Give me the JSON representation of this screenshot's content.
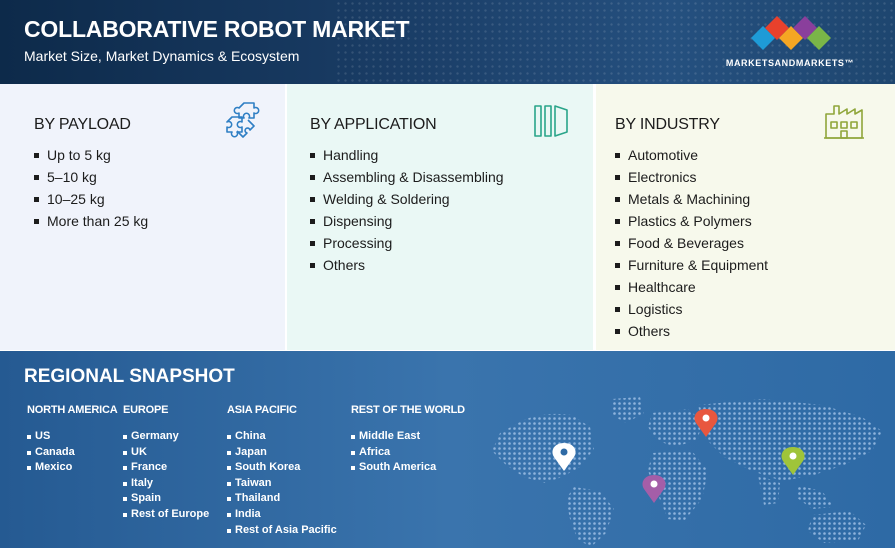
{
  "header": {
    "title": "COLLABORATIVE ROBOT MARKET",
    "subtitle": "Market Size, Market Dynamics & Ecosystem",
    "brand": "MARKETSANDMARKETS™",
    "logo_colors": [
      "#e8412c",
      "#f5a623",
      "#7ab648",
      "#1e9bd7",
      "#8a3f9c"
    ]
  },
  "segments": [
    {
      "heading": "BY PAYLOAD",
      "icon": "puzzle-icon",
      "items": [
        "Up to 5 kg",
        "5–10 kg",
        "10–25 kg",
        "More than 25 kg"
      ]
    },
    {
      "heading": "BY APPLICATION",
      "icon": "layers-icon",
      "items": [
        "Handling",
        "Assembling & Disassembling",
        "Welding & Soldering",
        "Dispensing",
        "Processing",
        "Others"
      ]
    },
    {
      "heading": "BY INDUSTRY",
      "icon": "factory-icon",
      "items": [
        "Automotive",
        "Electronics",
        "Metals & Machining",
        "Plastics & Polymers",
        "Food & Beverages",
        "Furniture & Equipment",
        "Healthcare",
        "Logistics",
        "Others"
      ]
    }
  ],
  "region": {
    "title": "REGIONAL SNAPSHOT",
    "columns": [
      {
        "heading": "NORTH AMERICA",
        "items": [
          "US",
          "Canada",
          "Mexico"
        ]
      },
      {
        "heading": "EUROPE",
        "items": [
          "Germany",
          "UK",
          "France",
          "Italy",
          "Spain",
          "Rest of Europe"
        ]
      },
      {
        "heading": "ASIA PACIFIC",
        "items": [
          "China",
          "Japan",
          "South Korea",
          "Taiwan",
          "Thailand",
          "India",
          "Rest of Asia Pacific"
        ]
      },
      {
        "heading": "REST OF THE WORLD",
        "items": [
          "Middle East",
          "Africa",
          "South America"
        ]
      }
    ],
    "map_pins": [
      {
        "name": "north-america-pin",
        "color": "#ffffff"
      },
      {
        "name": "europe-pin",
        "color": "#e8573f"
      },
      {
        "name": "asia-pacific-pin",
        "color": "#9fc43a"
      },
      {
        "name": "south-america-pin",
        "color": "#a45ea8"
      }
    ]
  },
  "colors": {
    "payload_icon": "#2f7fc4",
    "application_icon": "#2aa58a",
    "industry_icon": "#8fa63a"
  }
}
